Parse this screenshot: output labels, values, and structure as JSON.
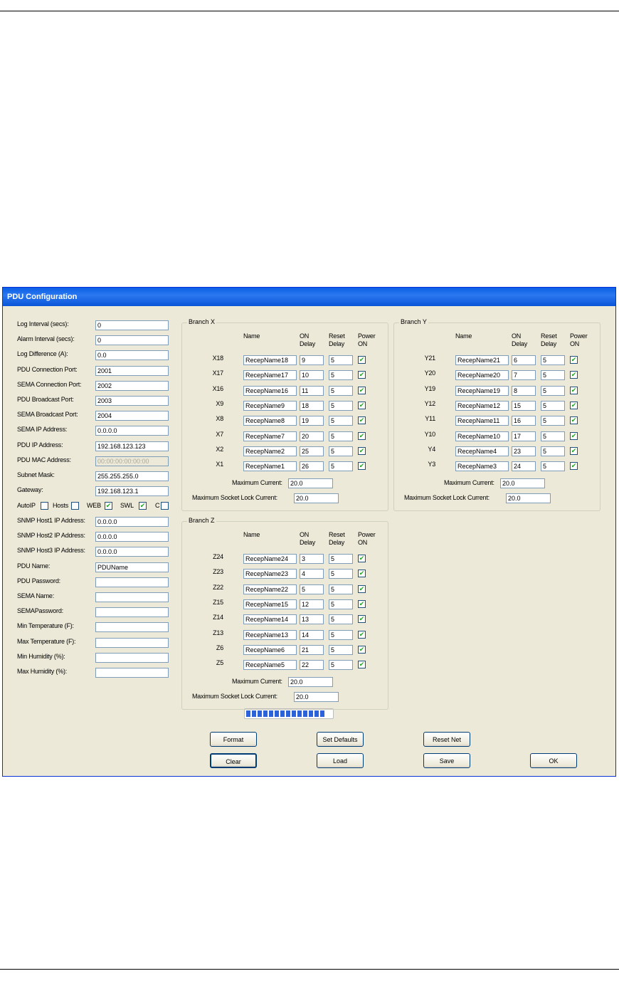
{
  "window": {
    "title": "PDU Configuration"
  },
  "settings": [
    {
      "label": "Log Interval (secs):",
      "value": "0"
    },
    {
      "label": "Alarm Interval (secs):",
      "value": "0"
    },
    {
      "label": "Log Difference (A):",
      "value": "0.0"
    },
    {
      "label": "PDU Connection Port:",
      "value": "2001"
    },
    {
      "label": "SEMA Connection Port:",
      "value": "2002"
    },
    {
      "label": "PDU Broadcast Port:",
      "value": "2003"
    },
    {
      "label": "SEMA Broadcast Port:",
      "value": "2004"
    },
    {
      "label": "SEMA IP Address:",
      "value": "0.0.0.0"
    },
    {
      "label": "PDU IP Address:",
      "value": "192.168.123.123"
    },
    {
      "label": "PDU MAC Address:",
      "value": "00:00:00:00:00:00",
      "disabled": true
    },
    {
      "label": "Subnet Mask:",
      "value": "255.255.255.0"
    },
    {
      "label": "Gateway:",
      "value": "192.168.123.1"
    }
  ],
  "options": [
    {
      "label": "AutoIP",
      "checked": false
    },
    {
      "label": "Hosts",
      "checked": false
    },
    {
      "label": "WEB",
      "checked": true
    },
    {
      "label": "SWL",
      "checked": true
    },
    {
      "label": "C",
      "checked": false
    }
  ],
  "settings2": [
    {
      "label": "SNMP Host1 IP Address:",
      "value": "0.0.0.0"
    },
    {
      "label": "SNMP Host2 IP Address:",
      "value": "0.0.0.0"
    },
    {
      "label": "SNMP Host3 IP Address:",
      "value": "0.0.0.0"
    },
    {
      "label": "PDU Name:",
      "value": "PDUName"
    },
    {
      "label": "PDU Password:",
      "value": ""
    },
    {
      "label": "SEMA Name:",
      "value": ""
    },
    {
      "label": "SEMAPassword:",
      "value": ""
    },
    {
      "label": "Min Temperature (F):",
      "value": ""
    },
    {
      "label": "Max Temperature (F):",
      "value": ""
    },
    {
      "label": "Min Humidity (%):",
      "value": ""
    },
    {
      "label": "Max Humidity (%):",
      "value": ""
    }
  ],
  "branch_headers": {
    "name": "Name",
    "on_delay": [
      "ON",
      "Delay"
    ],
    "reset_delay": [
      "Reset",
      "Delay"
    ],
    "power_on": [
      "Power",
      "ON"
    ]
  },
  "branches": [
    {
      "title": "Branch X",
      "max_current_label": "Maximum Current:",
      "max_current": "20.0",
      "max_lock_label": "Maximum Socket Lock Current:",
      "max_lock": "20.0",
      "rows": [
        {
          "id": "X18",
          "name": "RecepName18",
          "on": "9",
          "reset": "5",
          "power": true
        },
        {
          "id": "X17",
          "name": "RecepName17",
          "on": "10",
          "reset": "5",
          "power": true
        },
        {
          "id": "X16",
          "name": "RecepName16",
          "on": "11",
          "reset": "5",
          "power": true
        },
        {
          "id": "X9",
          "name": "RecepName9",
          "on": "18",
          "reset": "5",
          "power": true
        },
        {
          "id": "X8",
          "name": "RecepName8",
          "on": "19",
          "reset": "5",
          "power": true
        },
        {
          "id": "X7",
          "name": "RecepName7",
          "on": "20",
          "reset": "5",
          "power": true
        },
        {
          "id": "X2",
          "name": "RecepName2",
          "on": "25",
          "reset": "5",
          "power": true
        },
        {
          "id": "X1",
          "name": "RecepName1",
          "on": "26",
          "reset": "5",
          "power": true
        }
      ]
    },
    {
      "title": "Branch Y",
      "max_current_label": "Maximum Current:",
      "max_current": "20.0",
      "max_lock_label": "Maximum Socket Lock Current:",
      "max_lock": "20.0",
      "rows": [
        {
          "id": "Y21",
          "name": "RecepName21",
          "on": "6",
          "reset": "5",
          "power": true
        },
        {
          "id": "Y20",
          "name": "RecepName20",
          "on": "7",
          "reset": "5",
          "power": true
        },
        {
          "id": "Y19",
          "name": "RecepName19",
          "on": "8",
          "reset": "5",
          "power": true
        },
        {
          "id": "Y12",
          "name": "RecepName12",
          "on": "15",
          "reset": "5",
          "power": true
        },
        {
          "id": "Y11",
          "name": "RecepName11",
          "on": "16",
          "reset": "5",
          "power": true
        },
        {
          "id": "Y10",
          "name": "RecepName10",
          "on": "17",
          "reset": "5",
          "power": true
        },
        {
          "id": "Y4",
          "name": "RecepName4",
          "on": "23",
          "reset": "5",
          "power": true
        },
        {
          "id": "Y3",
          "name": "RecepName3",
          "on": "24",
          "reset": "5",
          "power": true
        }
      ]
    },
    {
      "title": "Branch Z",
      "max_current_label": "Maximum Current:",
      "max_current": "20.0",
      "max_lock_label": "Maximum Socket Lock Current:",
      "max_lock": "20.0",
      "rows": [
        {
          "id": "Z24",
          "name": "RecepName24",
          "on": "3",
          "reset": "5",
          "power": true
        },
        {
          "id": "Z23",
          "name": "RecepName23",
          "on": "4",
          "reset": "5",
          "power": true
        },
        {
          "id": "Z22",
          "name": "RecepName22",
          "on": "5",
          "reset": "5",
          "power": true
        },
        {
          "id": "Z15",
          "name": "RecepName15",
          "on": "12",
          "reset": "5",
          "power": true
        },
        {
          "id": "Z14",
          "name": "RecepName14",
          "on": "13",
          "reset": "5",
          "power": true
        },
        {
          "id": "Z13",
          "name": "RecepName13",
          "on": "14",
          "reset": "5",
          "power": true
        },
        {
          "id": "Z6",
          "name": "RecepName6",
          "on": "21",
          "reset": "5",
          "power": true
        },
        {
          "id": "Z5",
          "name": "RecepName5",
          "on": "22",
          "reset": "5",
          "power": true
        }
      ]
    }
  ],
  "progress": {
    "fraction": 0.96,
    "accent": "#2b62d9"
  },
  "buttons": {
    "format": "Format",
    "set_defaults": "Set Defaults",
    "reset_net": "Reset Net",
    "clear": "Clear",
    "load": "Load",
    "save": "Save",
    "ok": "OK"
  },
  "colors": {
    "titlebar": "#0a5fe6",
    "dialog_bg": "#ece9d8",
    "check": "#21a121"
  }
}
